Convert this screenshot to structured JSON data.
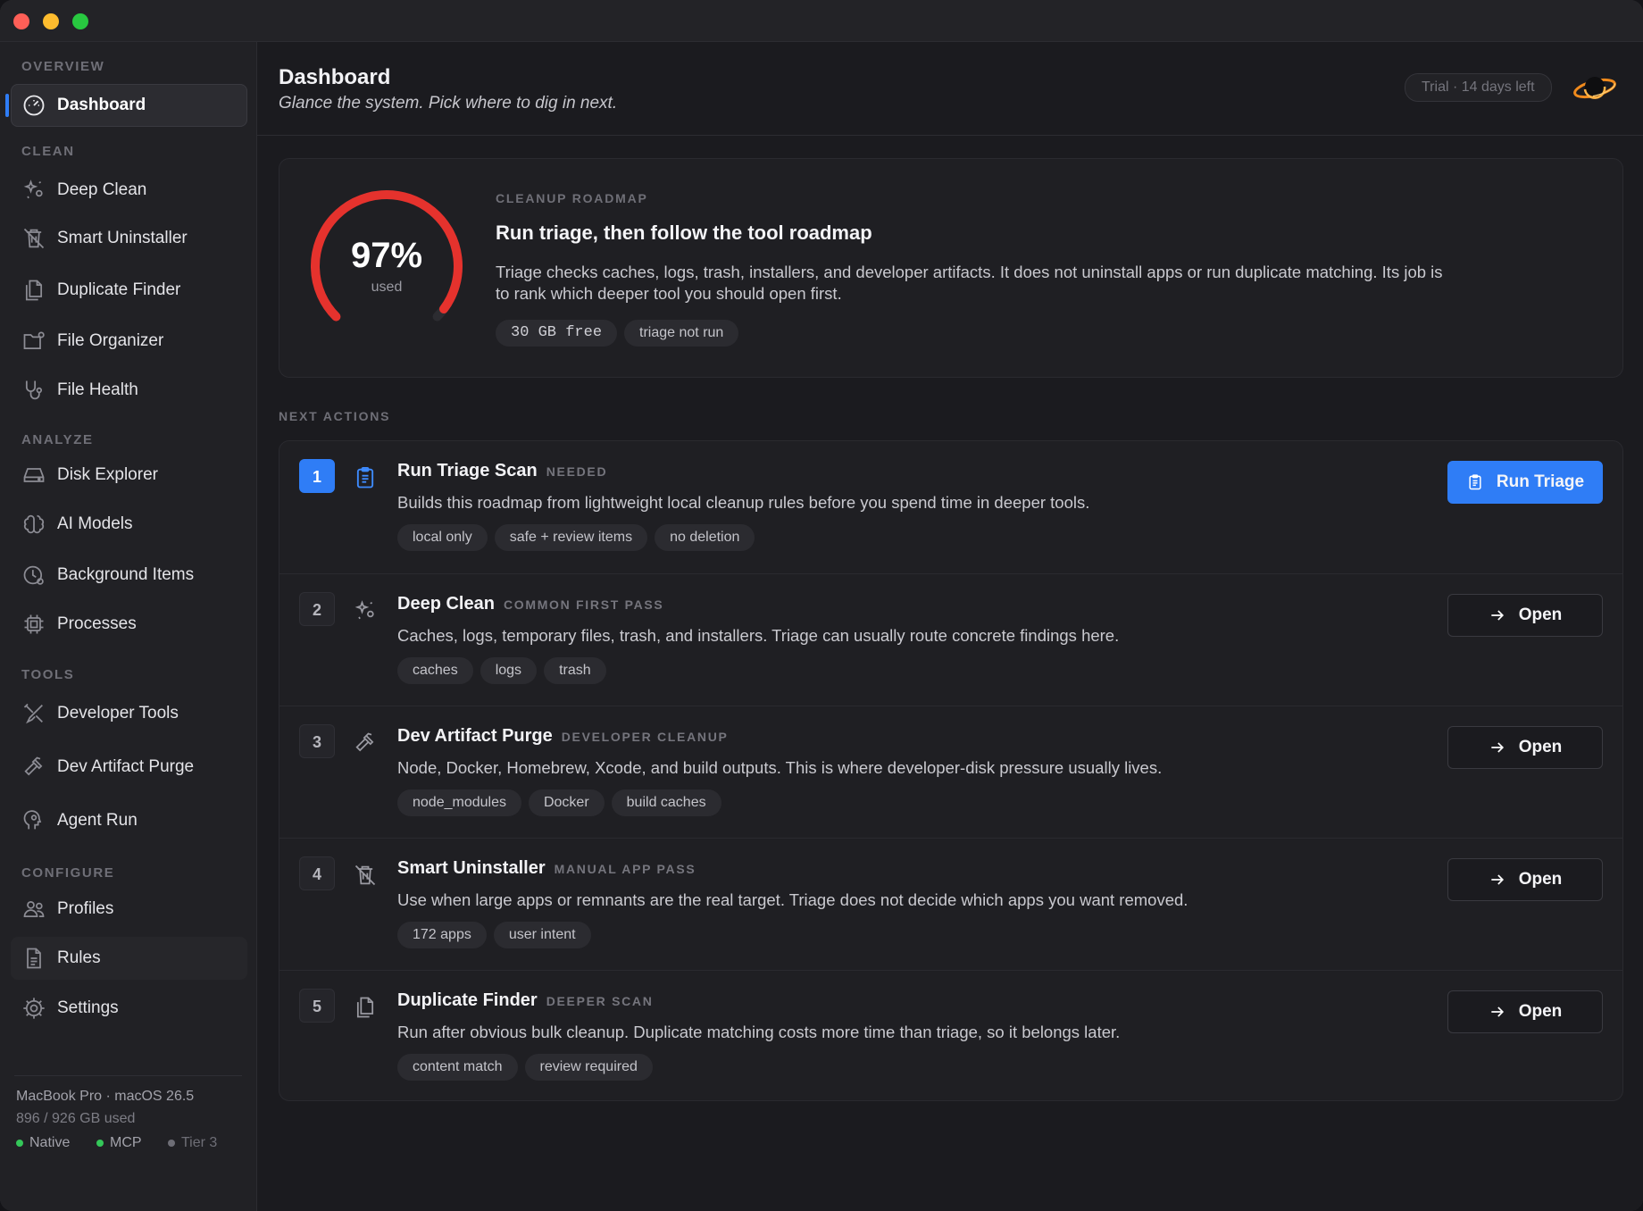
{
  "sidebar": {
    "sections": {
      "overview": "OVERVIEW",
      "clean": "CLEAN",
      "analyze": "ANALYZE",
      "tools": "TOOLS",
      "configure": "CONFIGURE"
    },
    "items": {
      "dashboard": {
        "label": "Dashboard",
        "icon": "gauge-icon"
      },
      "deep_clean": {
        "label": "Deep Clean",
        "icon": "sparkles-icon"
      },
      "smart_uninstaller": {
        "label": "Smart Uninstaller",
        "icon": "trash-app-icon"
      },
      "duplicate_finder": {
        "label": "Duplicate Finder",
        "icon": "copy-documents-icon"
      },
      "file_organizer": {
        "label": "File Organizer",
        "icon": "folder-gear-icon"
      },
      "file_health": {
        "label": "File Health",
        "icon": "stethoscope-icon"
      },
      "disk_explorer": {
        "label": "Disk Explorer",
        "icon": "drive-icon"
      },
      "ai_models": {
        "label": "AI Models",
        "icon": "brain-icon"
      },
      "background_items": {
        "label": "Background Items",
        "icon": "clock-gear-icon"
      },
      "processes": {
        "label": "Processes",
        "icon": "cpu-icon"
      },
      "developer_tools": {
        "label": "Developer Tools",
        "icon": "wrench-screwdriver-icon"
      },
      "dev_artifact_purge": {
        "label": "Dev Artifact Purge",
        "icon": "hammer-icon"
      },
      "agent_run": {
        "label": "Agent Run",
        "icon": "agent-head-icon"
      },
      "profiles": {
        "label": "Profiles",
        "icon": "people-icon"
      },
      "rules": {
        "label": "Rules",
        "icon": "document-rules-icon"
      },
      "settings": {
        "label": "Settings",
        "icon": "gear-icon"
      }
    },
    "footer": {
      "device": "MacBook Pro · macOS 26.5",
      "disk": "896 / 926 GB used",
      "status": [
        {
          "label": "Native",
          "color": "#34c759"
        },
        {
          "label": "MCP",
          "color": "#34c759"
        },
        {
          "label": "Tier 3",
          "color": "#6e6e76"
        }
      ]
    }
  },
  "header": {
    "title": "Dashboard",
    "subtitle": "Glance the system. Pick where to dig in next.",
    "trial": "Trial · 14 days left"
  },
  "roadmap": {
    "gauge_value": "97%",
    "gauge_fraction": 0.97,
    "gauge_caption": "used",
    "label": "CLEANUP ROADMAP",
    "title": "Run triage, then follow the tool roadmap",
    "description": "Triage checks caches, logs, trash, installers, and developer artifacts. It does not uninstall apps or run duplicate matching. Its job is to rank which deeper tool you should open first.",
    "chips": [
      "30 GB free",
      "triage not run"
    ]
  },
  "next_actions": {
    "label": "NEXT ACTIONS",
    "rows": [
      {
        "num": "1",
        "title": "Run Triage Scan",
        "badge": "NEEDED",
        "description": "Builds this roadmap from lightweight local cleanup rules before you spend time in deeper tools.",
        "chips": [
          "local only",
          "safe + review items",
          "no deletion"
        ],
        "button": "Run Triage",
        "icon": "clipboard-icon"
      },
      {
        "num": "2",
        "title": "Deep Clean",
        "badge": "COMMON FIRST PASS",
        "description": "Caches, logs, temporary files, trash, and installers. Triage can usually route concrete findings here.",
        "chips": [
          "caches",
          "logs",
          "trash"
        ],
        "button": "Open",
        "icon": "sparkles-icon"
      },
      {
        "num": "3",
        "title": "Dev Artifact Purge",
        "badge": "DEVELOPER CLEANUP",
        "description": "Node, Docker, Homebrew, Xcode, and build outputs. This is where developer-disk pressure usually lives.",
        "chips": [
          "node_modules",
          "Docker",
          "build caches"
        ],
        "button": "Open",
        "icon": "hammer-icon"
      },
      {
        "num": "4",
        "title": "Smart Uninstaller",
        "badge": "MANUAL APP PASS",
        "description": "Use when large apps or remnants are the real target. Triage does not decide which apps you want removed.",
        "chips": [
          "172 apps",
          "user intent"
        ],
        "button": "Open",
        "icon": "trash-app-icon"
      },
      {
        "num": "5",
        "title": "Duplicate Finder",
        "badge": "DEEPER SCAN",
        "description": "Run after obvious bulk cleanup. Duplicate matching costs more time than triage, so it belongs later.",
        "chips": [
          "content match",
          "review required"
        ],
        "button": "Open",
        "icon": "copy-documents-icon"
      }
    ]
  },
  "colors": {
    "accent": "#2f7df6",
    "gauge_red": "#e5322d",
    "background": "#1b1b1f",
    "sidebar": "#212125"
  }
}
